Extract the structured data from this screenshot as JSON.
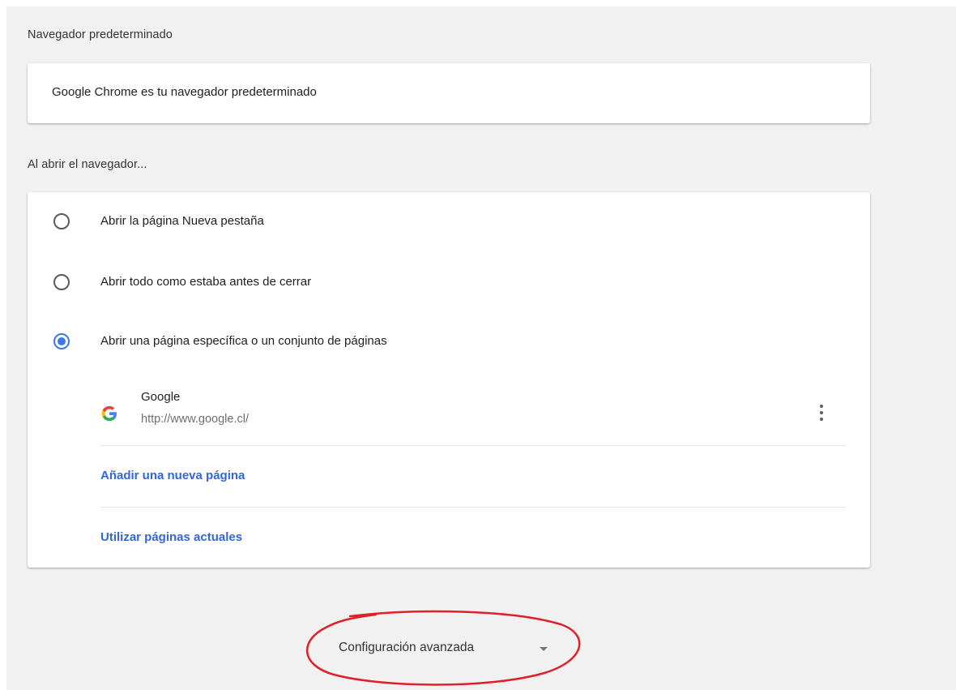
{
  "default_browser": {
    "section_title": "Navegador predeterminado",
    "status_text": "Google Chrome es tu navegador predeterminado"
  },
  "on_startup": {
    "section_title": "Al abrir el navegador...",
    "options": [
      {
        "label": "Abrir la página Nueva pestaña",
        "selected": false
      },
      {
        "label": "Abrir todo como estaba antes de cerrar",
        "selected": false
      },
      {
        "label": "Abrir una página específica o un conjunto de páginas",
        "selected": true
      }
    ],
    "pages": [
      {
        "name": "Google",
        "url": "http://www.google.cl/",
        "icon": "google-g-icon"
      }
    ],
    "add_page_label": "Añadir una nueva página",
    "use_current_label": "Utilizar páginas actuales"
  },
  "advanced": {
    "label": "Configuración avanzada",
    "icon": "chevron-down-icon"
  },
  "colors": {
    "accent": "#3b78e7",
    "link": "#3367d6",
    "annotation": "#e01f26",
    "background": "#f1f1f1"
  }
}
